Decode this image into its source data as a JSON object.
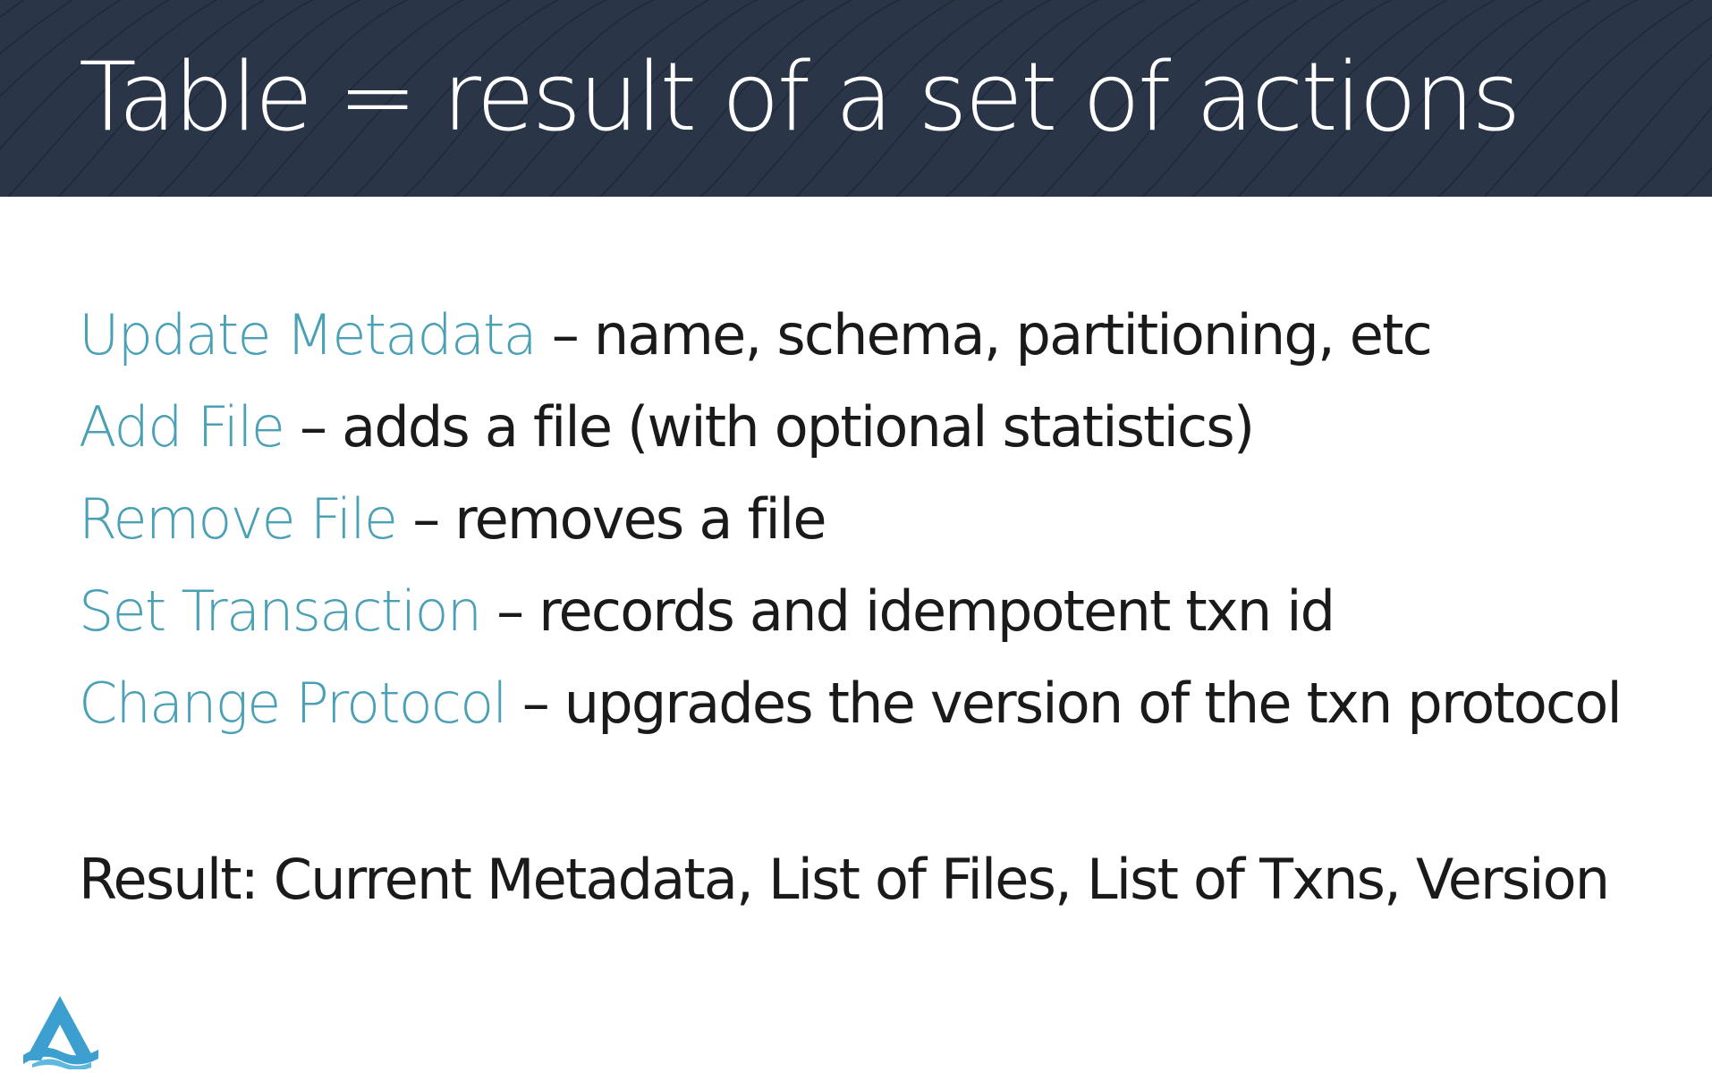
{
  "slide": {
    "title": "Table = result of a set of actions",
    "actions": [
      {
        "name": "Update Metadata",
        "desc": "– name, schema, partitioning, etc"
      },
      {
        "name": "Add File",
        "desc": "– adds a file (with optional statistics)"
      },
      {
        "name": "Remove File",
        "desc": "– removes a file"
      },
      {
        "name": "Set Transaction",
        "desc": "– records and idempotent txn id"
      },
      {
        "name": "Change Protocol",
        "desc": "– upgrades the version of the txn protocol"
      }
    ],
    "result": "Result: Current Metadata, List of Files, List of Txns, Version"
  },
  "colors": {
    "header_bg": "#2a3648",
    "accent": "#4aa0b4",
    "text": "#1a1a1a",
    "logo": "#3d9fd0"
  },
  "icons": {
    "logo": "delta-lake-logo-icon",
    "header_pattern": "wave-lines-pattern"
  }
}
